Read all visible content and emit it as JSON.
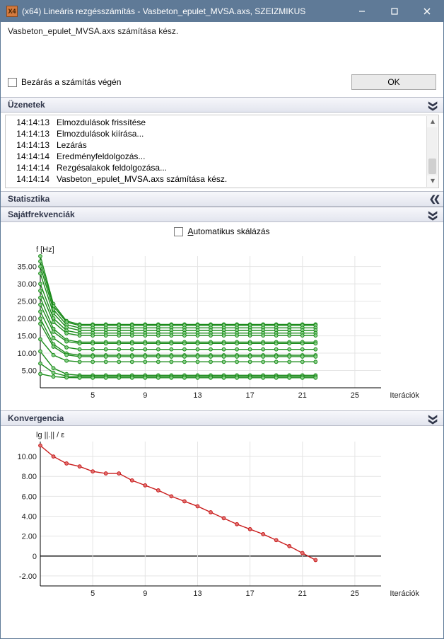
{
  "window": {
    "title": "(x64) Lineáris rezgésszámítás - Vasbeton_epulet_MVSA.axs, SZEIZMIKUS",
    "appicon_text": "X4"
  },
  "top_status": "Vasbeton_epulet_MVSA.axs számítása kész.",
  "close_checkbox": {
    "label": "Bezárás a számítás végén",
    "checked": false
  },
  "ok_button": "OK",
  "sections": {
    "messages_header": "Üzenetek",
    "stats_header": "Statisztika",
    "freq_header": "Sajátfrekvenciák",
    "conv_header": "Konvergencia"
  },
  "messages": [
    {
      "time": "14:14:13",
      "text": "Elmozdulások frissítése"
    },
    {
      "time": "14:14:13",
      "text": "Elmozdulások kiírása..."
    },
    {
      "time": "14:14:13",
      "text": "Lezárás"
    },
    {
      "time": "14:14:14",
      "text": "Eredményfeldolgozás..."
    },
    {
      "time": "14:14:14",
      "text": "Rezgésalakok feldolgozása..."
    },
    {
      "time": "14:14:14",
      "text": "Vasbeton_epulet_MVSA.axs számítása kész."
    }
  ],
  "autoscale": {
    "label": "Automatikus skálázás",
    "checked": false
  },
  "chart_data": [
    {
      "type": "line",
      "title": "Sajátfrekvenciák",
      "xlabel": "Iterációk",
      "ylabel": "f [Hz]",
      "xlim": [
        1,
        27
      ],
      "ylim": [
        0,
        38
      ],
      "xticks": [
        5,
        9,
        13,
        17,
        21,
        25
      ],
      "yticks": [
        5,
        10,
        15,
        20,
        25,
        30,
        35
      ],
      "ytick_labels": [
        "5.00",
        "10.00",
        "15.00",
        "20.00",
        "25.00",
        "30.00",
        "35.00"
      ],
      "colors": {
        "stroke": "#1a8a1a",
        "marker_fill": "#8ad08a"
      },
      "series": [
        {
          "name": "m1",
          "start": 38.0,
          "plateau": 18.3
        },
        {
          "name": "m2",
          "start": 36.5,
          "plateau": 18.0
        },
        {
          "name": "m3",
          "start": 35.0,
          "plateau": 17.3
        },
        {
          "name": "m4",
          "start": 33.0,
          "plateau": 16.6
        },
        {
          "name": "m5",
          "start": 30.0,
          "plateau": 15.8
        },
        {
          "name": "m6",
          "start": 28.0,
          "plateau": 15.1
        },
        {
          "name": "m7",
          "start": 26.0,
          "plateau": 13.2
        },
        {
          "name": "m8",
          "start": 24.0,
          "plateau": 12.8
        },
        {
          "name": "m9",
          "start": 22.0,
          "plateau": 11.1
        },
        {
          "name": "m10",
          "start": 20.0,
          "plateau": 9.4
        },
        {
          "name": "m11",
          "start": 18.5,
          "plateau": 9.0
        },
        {
          "name": "m12",
          "start": 14.0,
          "plateau": 7.5
        },
        {
          "name": "m13",
          "start": 10.5,
          "plateau": 3.6
        },
        {
          "name": "m14",
          "start": 7.0,
          "plateau": 3.2
        },
        {
          "name": "m15",
          "start": 4.0,
          "plateau": 2.9
        }
      ],
      "note": "Each series drops sharply from its start value over iterations 1–3 then remains nearly flat at the plateau value through iteration 22."
    },
    {
      "type": "line",
      "title": "Konvergencia",
      "xlabel": "Iterációk",
      "ylabel": "lg ||.|| / ε",
      "xlim": [
        1,
        27
      ],
      "ylim": [
        -3,
        11.5
      ],
      "xticks": [
        5,
        9,
        13,
        17,
        21,
        25
      ],
      "yticks": [
        -2,
        0,
        2,
        4,
        6,
        8,
        10
      ],
      "ytick_labels": [
        "-2.00",
        "0",
        "2.00",
        "4.00",
        "6.00",
        "8.00",
        "10.00"
      ],
      "colors": {
        "stroke": "#c91d1d",
        "marker_fill": "#e07070"
      },
      "series": [
        {
          "name": "convergence",
          "x": [
            1,
            2,
            3,
            4,
            5,
            6,
            7,
            8,
            9,
            10,
            11,
            12,
            13,
            14,
            15,
            16,
            17,
            18,
            19,
            20,
            21,
            22
          ],
          "y": [
            11.1,
            10.0,
            9.3,
            9.0,
            8.5,
            8.3,
            8.3,
            7.6,
            7.1,
            6.6,
            6.0,
            5.5,
            5.0,
            4.4,
            3.8,
            3.2,
            2.7,
            2.2,
            1.6,
            1.0,
            0.3,
            -0.4
          ]
        }
      ]
    }
  ]
}
